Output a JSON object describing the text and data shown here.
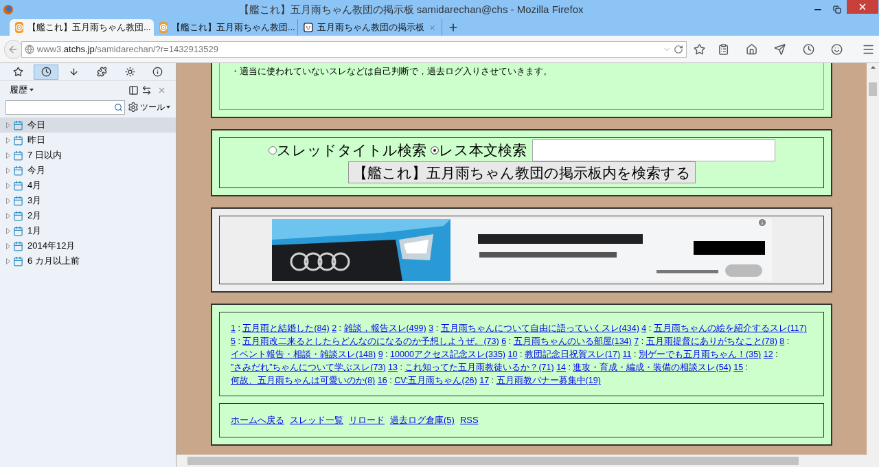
{
  "window": {
    "title": "【艦これ】五月雨ちゃん教団の掲示板 samidarechan@chs - Mozilla Firefox"
  },
  "tabs": [
    {
      "label": "【艦これ】五月雨ちゃん教団...",
      "kind": "at",
      "selected": true
    },
    {
      "label": "【艦これ】五月雨ちゃん教団...",
      "kind": "at",
      "selected": false
    },
    {
      "label": "五月雨ちゃん教団の掲示板",
      "kind": "face",
      "selected": false
    }
  ],
  "address": {
    "url_host_prefix": "www3.",
    "url_host": "atchs.jp",
    "url_path": "/samidarechan/?r=1432913529"
  },
  "sidebar": {
    "toolbar": [
      {
        "kind": "bookmarks",
        "selected": false
      },
      {
        "kind": "history",
        "selected": true
      },
      {
        "kind": "downloads",
        "selected": false
      },
      {
        "kind": "addons",
        "selected": false
      },
      {
        "kind": "burst",
        "selected": false
      },
      {
        "kind": "info",
        "selected": false
      }
    ],
    "title": "履歴",
    "tools": "ツール",
    "items": [
      {
        "label": "今日",
        "selected": true
      },
      {
        "label": "昨日",
        "selected": false
      },
      {
        "label": "7 日以内",
        "selected": false
      },
      {
        "label": "今月",
        "selected": false
      },
      {
        "label": "4月",
        "selected": false
      },
      {
        "label": "3月",
        "selected": false
      },
      {
        "label": "2月",
        "selected": false
      },
      {
        "label": "1月",
        "selected": false
      },
      {
        "label": "2014年12月",
        "selected": false
      },
      {
        "label": "6 カ月以上前",
        "selected": false
      }
    ]
  },
  "page": {
    "notice": "・適当に使われていないスレなどは自己判断で，過去ログ入りさせていきます。",
    "search": {
      "options": [
        {
          "label": "スレッドタイトル検索",
          "selected": false
        },
        {
          "label": "レス本文検索",
          "selected": true
        }
      ],
      "button": "【艦これ】五月雨ちゃん教団の掲示板内を検索する"
    },
    "ad": {
      "kind": "picture"
    },
    "threads": [
      {
        "number": "1",
        "separator": ":",
        "title": "五月雨と結婚した(84)"
      },
      {
        "number": "2",
        "separator": ":",
        "title": "雑談，報告スレ(499)"
      },
      {
        "number": "3",
        "separator": ":",
        "title": "五月雨ちゃんについて自由に語っていくスレ(434)"
      },
      {
        "number": "4",
        "separator": ":",
        "title": "五月雨ちゃんの絵を紹介するスレ(117)"
      },
      {
        "number": "5",
        "separator": ":",
        "title": "五月雨改二来るとしたらどんなのになるのか予想しようぜ。(73)"
      },
      {
        "number": "6",
        "separator": ":",
        "title": "五月雨ちゃんのいる部屋(134)"
      },
      {
        "number": "7",
        "separator": ":",
        "title": "五月雨提督にありがちなこと(78)"
      },
      {
        "number": "8",
        "separator": ":",
        "title": "イベント報告・相談・雑談スレ(148)"
      },
      {
        "number": "9",
        "separator": ":",
        "title": "10000アクセス記念スレ(335)"
      },
      {
        "number": "10",
        "separator": ":",
        "title": "教団記念日祝賀スレ(17)"
      },
      {
        "number": "11",
        "separator": ":",
        "title": "別ゲーでも五月雨ちゃん！(35)"
      },
      {
        "number": "12",
        "separator": ":",
        "title": "”さみだれ”ちゃんについて学ぶスレ(73)"
      },
      {
        "number": "13",
        "separator": ":",
        "title": "これ知ってた五月雨教徒いるか？(71)"
      },
      {
        "number": "14",
        "separator": ":",
        "title": "進攻・育成・編成・装備の相談スレ(54)"
      },
      {
        "number": "15",
        "separator": ":",
        "title": "何故、五月雨ちゃんは可愛いのか(8)"
      },
      {
        "number": "16",
        "separator": ":",
        "title": "CV:五月雨ちゃん(26)"
      },
      {
        "number": "17",
        "separator": ":",
        "title": "五月雨教バナー募集中(19)"
      }
    ],
    "footer_links": [
      "ホームへ戻る",
      "スレッド一覧",
      "リロード",
      "過去ログ倉庫(5)",
      "RSS"
    ]
  }
}
